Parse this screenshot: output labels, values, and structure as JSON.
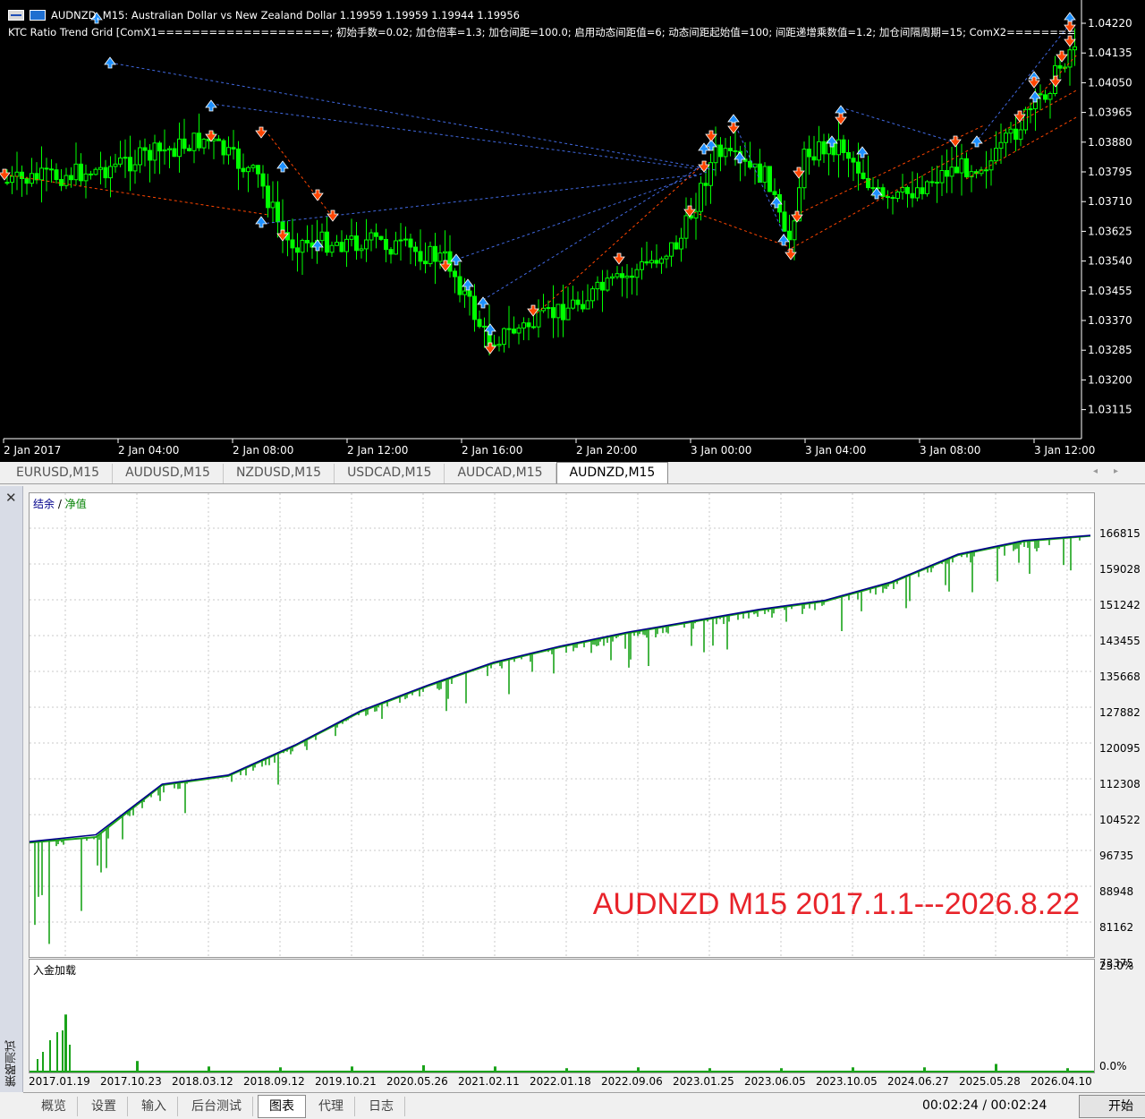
{
  "price_chart": {
    "title_symbol": "AUDNZD, M15:",
    "title_desc": "Australian Dollar vs New Zealand Dollar",
    "title_ohlc": "1.19959 1.19959 1.19944 1.19956",
    "indicator_line": "KTC Ratio Trend Grid [ComX1====================; 初始手数=0.02; 加仓倍率=1.3; 加仓间距=100.0; 启用动态间距值=6; 动态间距起始值=100; 间距递增乘数值=1.2; 加仓间隔周期=15; ComX2========",
    "price_labels": [
      "1.04220",
      "1.04135",
      "1.04050",
      "1.03965",
      "1.03880",
      "1.03795",
      "1.03710",
      "1.03625",
      "1.03540",
      "1.03455",
      "1.03370",
      "1.03285",
      "1.03200",
      "1.03115"
    ],
    "time_labels": [
      "2 Jan 2017",
      "2 Jan 04:00",
      "2 Jan 08:00",
      "2 Jan 12:00",
      "2 Jan 16:00",
      "2 Jan 20:00",
      "3 Jan 00:00",
      "3 Jan 04:00",
      "3 Jan 08:00",
      "3 Jan 12:00"
    ],
    "colors": {
      "background": "#000000",
      "candle": "#00ff00",
      "buy_arrow": "#1e90ff",
      "sell_arrow": "#ff4500",
      "buy_line": "#4169e1",
      "sell_line": "#ff4500"
    }
  },
  "symbol_tabs": [
    "EURUSD,M15",
    "AUDUSD,M15",
    "NZDUSD,M15",
    "USDCAD,M15",
    "AUDCAD,M15",
    "AUDNZD,M15"
  ],
  "active_symbol_tab": "AUDNZD,M15",
  "tester": {
    "side_label": "策略测试",
    "legend_balance": "结余",
    "legend_sep": " / ",
    "legend_equity": "净值",
    "watermark": "AUDNZD M15 2017.1.1---2026.8.22",
    "equity_y_labels": [
      "166815",
      "159028",
      "151242",
      "143455",
      "135668",
      "127882",
      "120095",
      "112308",
      "104522",
      "96735",
      "88948",
      "81162",
      "73375"
    ],
    "deposit_title": "入金加载",
    "deposit_y_labels": [
      "25.0%",
      "0.0%"
    ],
    "x_dates": [
      "2017.01.19",
      "2017.10.23",
      "2018.03.12",
      "2018.09.12",
      "2019.10.21",
      "2020.05.26",
      "2021.02.11",
      "2022.01.18",
      "2022.09.06",
      "2023.01.25",
      "2023.06.05",
      "2023.10.05",
      "2024.06.27",
      "2025.05.28",
      "2026.04.10"
    ],
    "bottom_tabs": [
      "概览",
      "设置",
      "输入",
      "后台测试",
      "图表",
      "代理",
      "日志"
    ],
    "active_bottom_tab": "图表",
    "timer": "00:02:24 / 00:02:24",
    "start_button": "开始",
    "colors": {
      "balance": "#00008b",
      "equity": "#1aa31a",
      "deposit": "#1aa31a"
    }
  },
  "chart_data": [
    {
      "type": "line",
      "title": "",
      "xlabel": "",
      "ylabel": "",
      "ylim": [
        73375,
        166815
      ],
      "x": [
        "2017.01.01",
        "2017.01.19",
        "2017.10.23",
        "2018.03.12",
        "2018.09.12",
        "2019.10.21",
        "2020.05.26",
        "2021.02.11",
        "2022.01.18",
        "2022.09.06",
        "2023.01.25",
        "2023.06.05",
        "2023.10.05",
        "2024.06.27",
        "2025.05.28",
        "2026.04.10",
        "2026.08.22"
      ],
      "series": [
        {
          "name": "结余",
          "values": [
            100000,
            101500,
            112500,
            114500,
            121000,
            128500,
            134000,
            139000,
            142500,
            145500,
            148000,
            150500,
            152500,
            156500,
            162500,
            165500,
            166600
          ]
        },
        {
          "name": "净值",
          "values": [
            99800,
            101000,
            112300,
            114300,
            120800,
            128300,
            133800,
            138800,
            142300,
            145300,
            147800,
            150300,
            152300,
            156300,
            162300,
            165300,
            166500
          ]
        }
      ]
    },
    {
      "type": "bar",
      "title": "入金加载",
      "ylim": [
        0,
        25
      ],
      "categories": [
        "2017.01.19",
        "2017.10.23",
        "2018.03.12",
        "2018.09.12",
        "2019.10.21",
        "2020.05.26",
        "2021.02.11",
        "2022.01.18",
        "2022.09.06",
        "2023.01.25",
        "2023.06.05",
        "2023.10.05",
        "2024.06.27",
        "2025.05.28",
        "2026.04.10"
      ],
      "values": [
        13.5,
        2.5,
        1.2,
        1.0,
        1.2,
        1.5,
        1.2,
        0.8,
        1.0,
        0.8,
        0.8,
        1.0,
        1.0,
        1.8,
        0.8
      ]
    }
  ]
}
